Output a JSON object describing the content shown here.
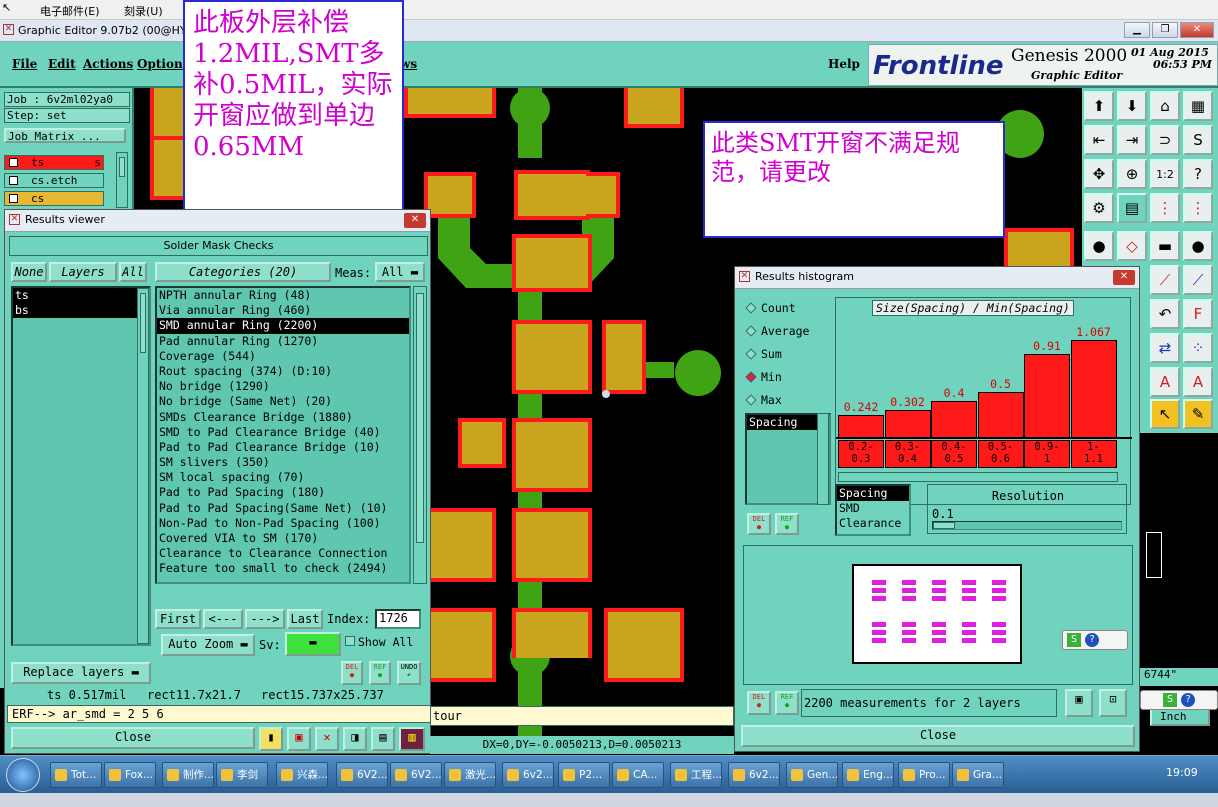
{
  "host_menu": {
    "email": "电子邮件(E)",
    "burn": "刻录(U)"
  },
  "title": "Graphic Editor 9.07b2 (00@HY-HY",
  "menubar": {
    "file": "File",
    "edit": "Edit",
    "actions": "Actions",
    "options": "Options",
    "views_tail": "ws",
    "help": "Help"
  },
  "brand": {
    "logo": "Frontline",
    "product": "Genesis 2000",
    "subtitle": "Graphic Editor",
    "date": "01 Aug 2015",
    "time": "06:53 PM"
  },
  "left_panel": {
    "job": "Job : 6v2ml02ya0",
    "step": "Step: set",
    "job_matrix": "Job Matrix ...",
    "layers": [
      {
        "name": "ts",
        "color": "#ff1a1a",
        "suffix": "s"
      },
      {
        "name": "cs.etch",
        "color": "#6fd3bd",
        "suffix": ""
      },
      {
        "name": "cs",
        "color": "#e8b832",
        "suffix": ""
      }
    ]
  },
  "notes": {
    "left": "此板外层补偿1.2MIL,SMT多补0.5MIL，实际开窗应做到单边0.65MM",
    "right": "此类SMT开窗不满足规范，请更改"
  },
  "results_viewer": {
    "title": "Results viewer",
    "header": "Solder Mask Checks",
    "none_btn": "None",
    "layers_btn": "Layers",
    "all_btn": "All",
    "categories_label": "Categories (20)",
    "meas_label": "Meas:",
    "meas_value": "All",
    "layer_list": [
      "ts",
      "bs"
    ],
    "categories": [
      "NPTH annular Ring (48)",
      "Via annular Ring (460)",
      "SMD annular Ring (2200)",
      "Pad annular Ring (1270)",
      "Coverage (544)",
      "Rout spacing (374)        (D:10)",
      "No bridge (1290)",
      "No bridge (Same Net) (20)",
      "SMDs Clearance Bridge (1880)",
      "SMD to Pad Clearance Bridge (40)",
      "Pad to Pad Clearance Bridge (10)",
      "SM slivers (350)",
      "SM local spacing (70)",
      "Pad to Pad Spacing (180)",
      "Pad to Pad Spacing(Same Net) (10)",
      "Non-Pad to Non-Pad Spacing (100)",
      "Covered VIA to SM (170)",
      "Clearance to Clearance Connection",
      "Feature too small to check (2494)"
    ],
    "selected_category": 2,
    "nav": {
      "first": "First",
      "prev": "<---",
      "next": "--->",
      "last": "Last",
      "index_label": "Index:",
      "index_value": "1726"
    },
    "auto_zoom": "Auto Zoom",
    "sv_label": "Sv:",
    "show_all": "Show All",
    "replace_layers": "Replace layers",
    "del": "DEL",
    "ref": "REF",
    "undo": "UNDO",
    "status": {
      "layer": "ts 0.517mil",
      "rect1": "rect11.7x21.7",
      "rect2": "rect15.737x25.737"
    },
    "erf": "ERF--> ar_smd = 2 5 6",
    "close": "Close"
  },
  "histogram": {
    "title": "Results histogram",
    "stat_options": [
      "Count",
      "Average",
      "Sum",
      "Min",
      "Max"
    ],
    "stat_selected": "Min",
    "spacing_list": [
      "Spacing"
    ],
    "chart_title": "Size(Spacing) / Min(Spacing)",
    "type_list": [
      "Spacing",
      "SMD",
      "Clearance"
    ],
    "resolution_label": "Resolution",
    "resolution_value": "0.1",
    "measurements": "2200 measurements for 2 layers",
    "close": "Close",
    "del": "DEL",
    "ref": "REF"
  },
  "chart_data": {
    "type": "bar",
    "title": "Size(Spacing) / Min(Spacing)",
    "categories": [
      "0.2-\n0.3",
      "0.3-\n0.4",
      "0.4-\n0.5",
      "0.5-\n0.6",
      "0.9-\n1",
      "1-\n1.1"
    ],
    "values": [
      0.242,
      0.302,
      0.4,
      0.5,
      0.91,
      1.067
    ],
    "value_labels": [
      "0.242",
      "0.302",
      "0.4",
      "0.5",
      "0.91",
      "1.067"
    ],
    "ylim": [
      0,
      1.1
    ],
    "color": "#ff1a1a"
  },
  "coords": "DX=0,DY=-0.0050213,D=0.0050213",
  "coord_right": "6744\"",
  "units": "Inch",
  "contour_tail": "tour",
  "taskbar": {
    "items": [
      "Tot...",
      "Fox...",
      "制作...",
      "李剑",
      "兴森...",
      "6V2...",
      "6V2...",
      "激光...",
      "6v2...",
      "P2...",
      "CA...",
      "工程...",
      "6v2...",
      "Gen...",
      "Eng...",
      "Pro...",
      "Gra..."
    ],
    "clock": "19:09"
  }
}
